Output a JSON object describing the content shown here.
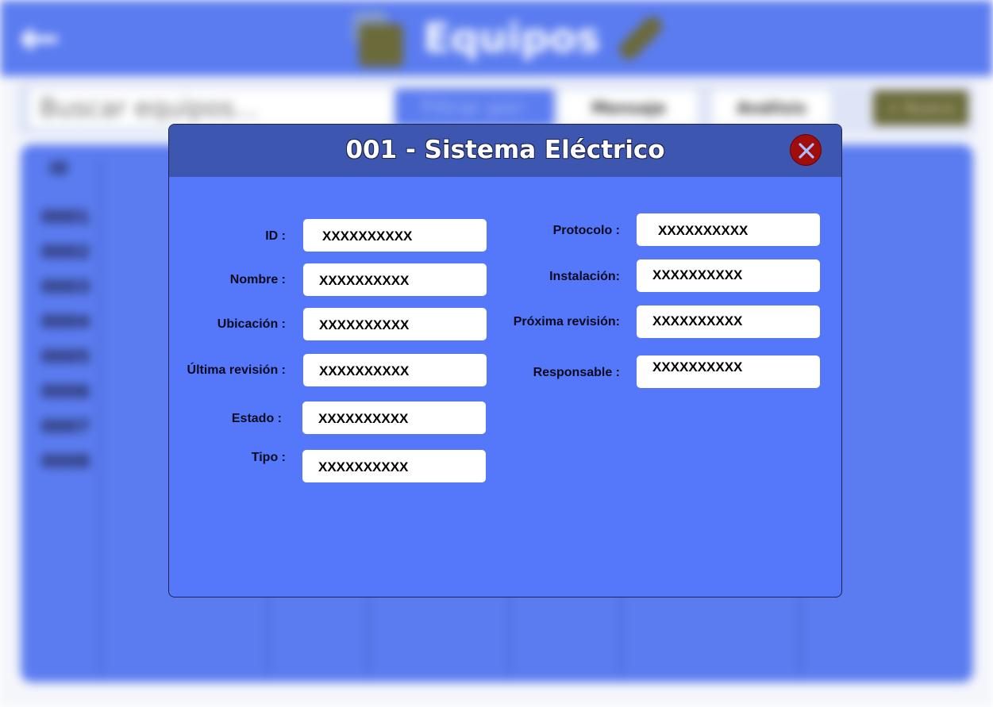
{
  "background": {
    "app_title": "Equipos",
    "search_placeholder": "Buscar equipos...",
    "filter_label": "Filtrar por:",
    "chip1_label": "Mensaje",
    "chip2_label": "Análisis",
    "new_label": "+ Nuevo",
    "col_id_header": "ID",
    "rows": [
      "0001",
      "0002",
      "0003",
      "0004",
      "0005",
      "0006",
      "0007",
      "0008"
    ]
  },
  "modal": {
    "title": "001 - Sistema Eléctrico",
    "left_fields": [
      {
        "label": "ID :",
        "value": "XXXXXXXXXX"
      },
      {
        "label": "Nombre :",
        "value": "XXXXXXXXXX"
      },
      {
        "label": "Ubicación :",
        "value": "XXXXXXXXXX"
      },
      {
        "label": "Última revisión :",
        "value": "XXXXXXXXXX"
      },
      {
        "label": "Estado :",
        "value": "XXXXXXXXXX"
      },
      {
        "label": "Tipo :",
        "value": "XXXXXXXXXX"
      }
    ],
    "right_fields": [
      {
        "label": "Protocolo :",
        "value": "XXXXXXXXXX"
      },
      {
        "label": "Instalación:",
        "value": "XXXXXXXXXX"
      },
      {
        "label": "Próxima revisión:",
        "value": "XXXXXXXXXX"
      },
      {
        "label": "Responsable :",
        "value": "XXXXXXXXXX"
      }
    ]
  }
}
